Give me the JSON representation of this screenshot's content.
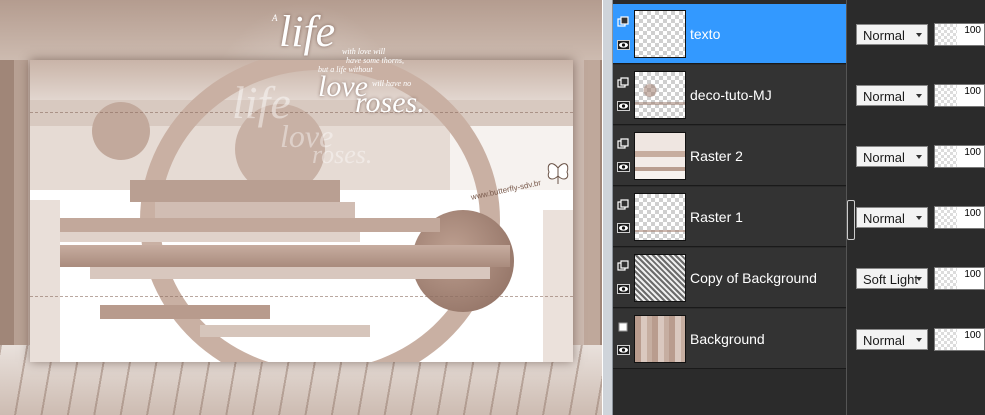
{
  "canvas": {
    "watermark": {
      "life": "life",
      "a": "A",
      "with_love": "with love will",
      "thorns": "have some thorns,",
      "but_a": "but a life without",
      "love": "love",
      "will_have_no": "will have no",
      "roses": "roses.",
      "ghost_life": "life",
      "ghost_love": "love",
      "ghost_roses": "roses.",
      "site": "www.butterfly-sdv.br"
    }
  },
  "layers_panel": {
    "layers": [
      {
        "name": "texto",
        "blend_mode": "Normal",
        "opacity": 100,
        "selected": true,
        "type": "raster"
      },
      {
        "name": "deco-tuto-MJ",
        "blend_mode": "Normal",
        "opacity": 100,
        "selected": false,
        "type": "raster"
      },
      {
        "name": "Raster 2",
        "blend_mode": "Normal",
        "opacity": 100,
        "selected": false,
        "type": "raster"
      },
      {
        "name": "Raster 1",
        "blend_mode": "Normal",
        "opacity": 100,
        "selected": false,
        "type": "raster"
      },
      {
        "name": "Copy of Background",
        "blend_mode": "Soft Light",
        "opacity": 100,
        "selected": false,
        "type": "raster"
      },
      {
        "name": "Background",
        "blend_mode": "Normal",
        "opacity": 100,
        "selected": false,
        "type": "background"
      }
    ]
  },
  "colors": {
    "selected_row": "#3399ff",
    "panel_bg": "#2b2b2b",
    "row_bg": "#333333",
    "sepia_accent": "#a08678"
  },
  "icons": {
    "layer_type": "raster-layer-icon",
    "visibility": "eye-icon",
    "dropdown": "chevron-down-icon"
  }
}
